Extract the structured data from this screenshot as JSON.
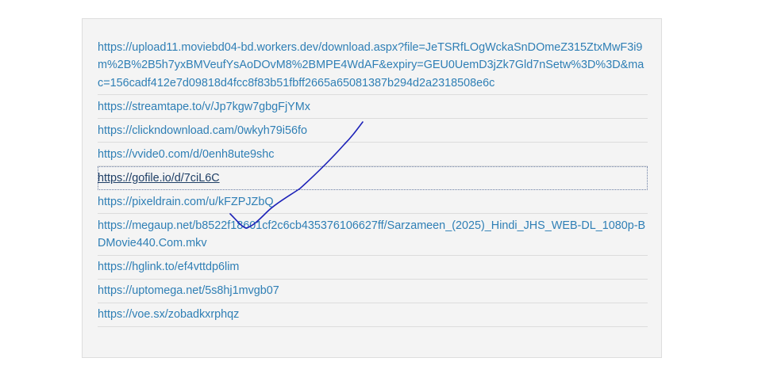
{
  "links": [
    {
      "url": "https://upload11.moviebd04-bd.workers.dev/download.aspx?file=JeTSRfLOgWckaSnDOmeZ315ZtxMwF3i9m%2B%2B5h7yxBMVeufYsAoDOvM8%2BMPE4WdAF&expiry=GEU0UemD3jZk7Gld7nSetw%3D%3D&mac=156cadf412e7d09818d4fcc8f83b51fbff2665a65081387b294d2a2318508e6c"
    },
    {
      "url": "https://streamtape.to/v/Jp7kgw7gbgFjYMx"
    },
    {
      "url": "https://clickndownload.cam/0wkyh79i56fo"
    },
    {
      "url": "https://vvide0.com/d/0enh8ute9shc"
    },
    {
      "url": "https://gofile.io/d/7ciL6C"
    },
    {
      "url": "https://pixeldrain.com/u/kFZPJZbQ"
    },
    {
      "url": "https://megaup.net/b8522f18601cf2c6cb435376106627ff/Sarzameen_(2025)_Hindi_JHS_WEB-DL_1080p-BDMovie440.Com.mkv"
    },
    {
      "url": "https://hglink.to/ef4vttdp6lim"
    },
    {
      "url": "https://uptomega.net/5s8hj1mvgb07"
    },
    {
      "url": "https://voe.sx/zobadkxrphqz"
    }
  ],
  "focused_index": 4,
  "colors": {
    "link": "#2f7fb5",
    "focused_link": "#1f3f66",
    "panel_bg": "#f4f4f4",
    "annotation_stroke": "#1d22b8"
  }
}
